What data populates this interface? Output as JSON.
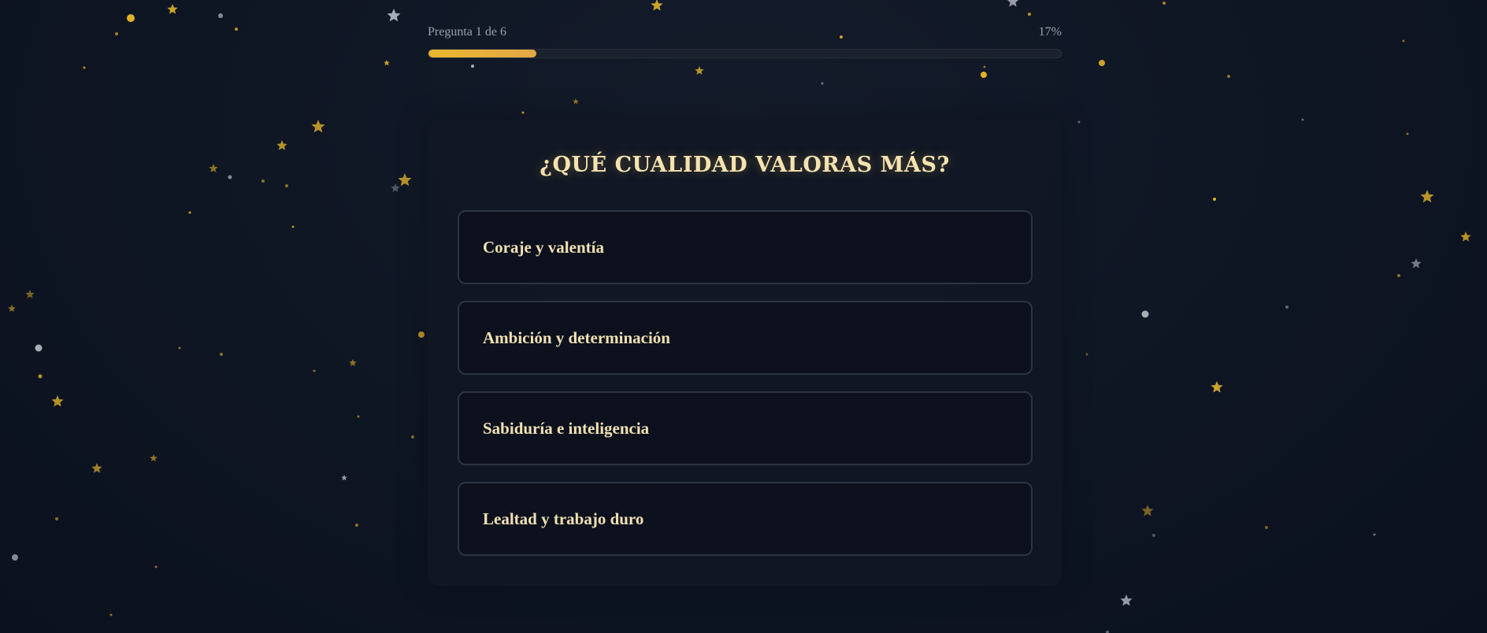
{
  "progress": {
    "label": "Pregunta 1 de 6",
    "percent_text": "17%",
    "value": 0.17
  },
  "question": {
    "title": "¿QUÉ CUALIDAD VALORAS MÁS?"
  },
  "options": [
    {
      "label": "Coraje y valentía"
    },
    {
      "label": "Ambición y determinación"
    },
    {
      "label": "Sabiduría e inteligencia"
    },
    {
      "label": "Lealtad y trabajo duro"
    }
  ],
  "colors": {
    "accent": "#e9b72e",
    "star_gold": "#e0b12a",
    "star_silver": "#b9bcc4",
    "text": "#f3e2b3",
    "background": "#0f1624"
  },
  "decoration": {
    "icon": "star-icon"
  }
}
